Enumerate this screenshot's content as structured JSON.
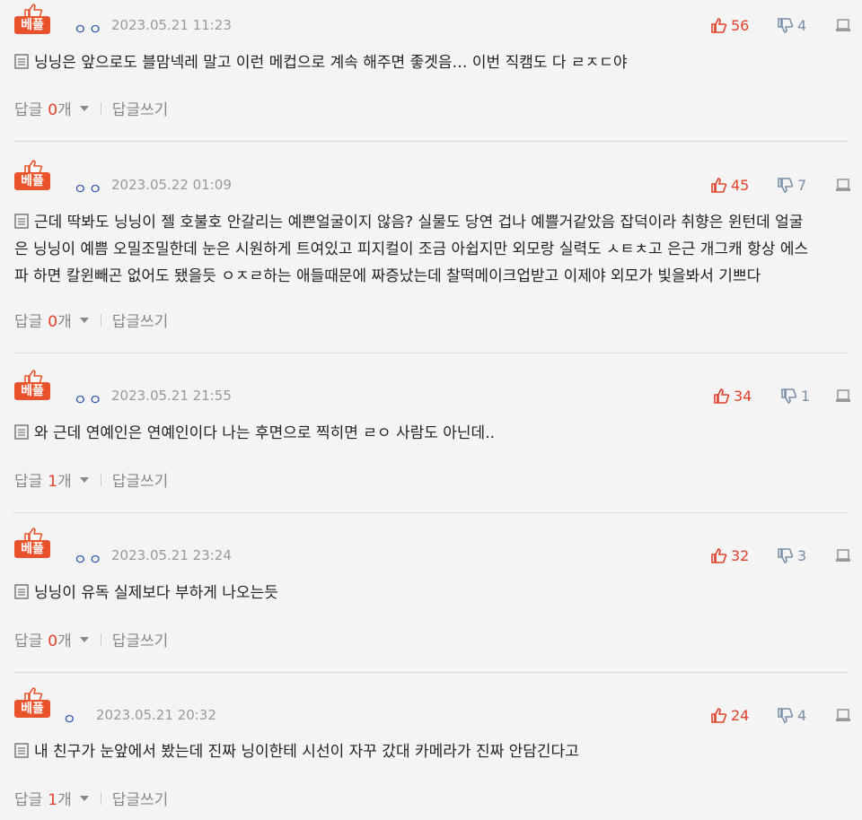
{
  "comments": [
    {
      "badge": "베플",
      "nick": "ㅇㅇ",
      "date": "2023.05.21 11:23",
      "up": "56",
      "down": "4",
      "lines": [
        "닝닝은 앞으로도 블맘넥레 말고 이런 메컵으로 계속 해주면 좋겟음… 이번 직캠도 다 ㄹㅈㄷ야"
      ],
      "reply_label": "답글",
      "reply_count": "0",
      "reply_unit": "개",
      "write_label": "답글쓰기"
    },
    {
      "badge": "베플",
      "nick": "ㅇㅇ",
      "date": "2023.05.22 01:09",
      "up": "45",
      "down": "7",
      "lines": [
        "근데 딱봐도 닝닝이 젤 호불호 안갈리는 예쁜얼굴이지 않음? 실물도 당연 겁나 예쁠거같았음 잡덕이라 취향은 윈턴데 얼굴",
        "은 닝닝이 예쁨 오밀조밀한데 눈은 시원하게 트여있고 피지컬이 조금 아쉽지만 외모랑 실력도 ㅅㅌㅊ고 은근 개그캐 항상 에스",
        "파 하면 칼윈빼곤 없어도 됐을듯 ㅇㅈㄹ하는 애들때문에 짜증났는데 찰떡메이크업받고 이제야 외모가 빛을봐서 기쁘다"
      ],
      "reply_label": "답글",
      "reply_count": "0",
      "reply_unit": "개",
      "write_label": "답글쓰기"
    },
    {
      "badge": "베플",
      "nick": "ㅇㅇ",
      "date": "2023.05.21 21:55",
      "up": "34",
      "down": "1",
      "lines": [
        "와 근데 연예인은 연예인이다 나는 후면으로 찍히면 ㄹㅇ 사람도 아닌데.."
      ],
      "reply_label": "답글",
      "reply_count": "1",
      "reply_unit": "개",
      "write_label": "답글쓰기"
    },
    {
      "badge": "베플",
      "nick": "ㅇㅇ",
      "date": "2023.05.21 23:24",
      "up": "32",
      "down": "3",
      "lines": [
        "닝닝이 유독 실제보다 부하게 나오는듯"
      ],
      "reply_label": "답글",
      "reply_count": "0",
      "reply_unit": "개",
      "write_label": "답글쓰기"
    },
    {
      "badge": "베플",
      "nick": "ㅇ",
      "date": "2023.05.21 20:32",
      "up": "24",
      "down": "4",
      "lines": [
        "내 친구가 눈앞에서 봤는데 진짜 닝이한테 시선이 자꾸 갔대 카메라가 진짜 안담긴다고"
      ],
      "reply_label": "답글",
      "reply_count": "1",
      "reply_unit": "개",
      "write_label": "답글쓰기"
    }
  ],
  "colors": {
    "badge": "#e8532b",
    "upvote": "#e0412b",
    "downvote": "#7a8fa8",
    "nick": "#2b52b0",
    "reply_count": "#e0412b"
  },
  "icons": {
    "badge": "thumbs-up-icon",
    "upvote": "thumbs-up-icon",
    "downvote": "thumbs-down-icon",
    "report": "report-icon",
    "document": "document-icon",
    "caret": "chevron-down-icon"
  }
}
